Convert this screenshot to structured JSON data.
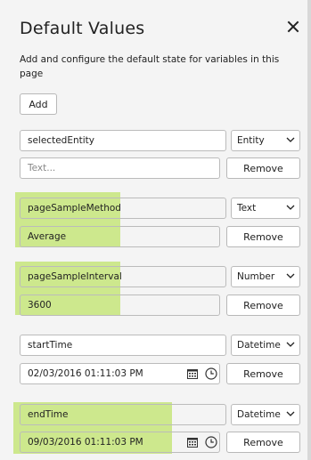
{
  "panel": {
    "title": "Default Values",
    "description": "Add and configure the default state for variables in this page",
    "add_label": "Add",
    "remove_label": "Remove",
    "highlight_color": "#c5e57a"
  },
  "variables": [
    {
      "name": "selectedEntity",
      "type": "Entity",
      "value": "",
      "value_placeholder": "Text...",
      "highlighted": false
    },
    {
      "name": "pageSampleMethod",
      "type": "Text",
      "value": "Average",
      "highlighted": true
    },
    {
      "name": "pageSampleInterval",
      "type": "Number",
      "value": "3600",
      "highlighted": true
    },
    {
      "name": "startTime",
      "type": "Datetime",
      "value": "02/03/2016 01:11:03 PM",
      "highlighted": false
    },
    {
      "name": "endTime",
      "type": "Datetime",
      "value": "09/03/2016 01:11:03 PM",
      "highlighted": true
    }
  ],
  "icons": {
    "close": "close-icon",
    "dropdown": "chevron-down-icon",
    "calendar": "calendar-icon",
    "clock": "clock-icon"
  }
}
